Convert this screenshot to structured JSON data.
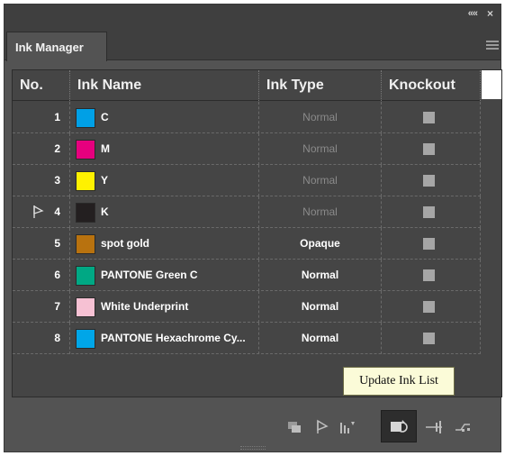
{
  "panel": {
    "tab_label": "Ink Manager",
    "collapse_glyph": "««",
    "close_glyph": "×"
  },
  "table": {
    "headers": {
      "no": "No.",
      "name": "Ink Name",
      "type": "Ink Type",
      "knockout": "Knockout"
    },
    "rows": [
      {
        "no": "1",
        "name": "C",
        "color": "#00a0e6",
        "type": "Normal",
        "type_style": "dim",
        "flag": false
      },
      {
        "no": "2",
        "name": "M",
        "color": "#e6007e",
        "type": "Normal",
        "type_style": "dim",
        "flag": false
      },
      {
        "no": "3",
        "name": "Y",
        "color": "#fff100",
        "type": "Normal",
        "type_style": "dim",
        "flag": false
      },
      {
        "no": "4",
        "name": "K",
        "color": "#231f20",
        "type": "Normal",
        "type_style": "dim",
        "flag": true
      },
      {
        "no": "5",
        "name": "spot gold",
        "color": "#b8720f",
        "type": "Opaque",
        "type_style": "bright",
        "flag": false
      },
      {
        "no": "6",
        "name": "PANTONE Green C",
        "color": "#00a884",
        "type": "Normal",
        "type_style": "bright",
        "flag": false
      },
      {
        "no": "7",
        "name": "White Underprint",
        "color": "#f6c1d3",
        "type": "Normal",
        "type_style": "bright",
        "flag": false
      },
      {
        "no": "8",
        "name": "PANTONE Hexachrome Cy...",
        "color": "#00a6e8",
        "type": "Normal",
        "type_style": "bright",
        "flag": false
      }
    ]
  },
  "tooltip": {
    "text": "Update Ink List"
  },
  "toolbar": {
    "icons": [
      "ink-layer-icon",
      "flag-icon",
      "sort-icon",
      "update-ink-list-icon",
      "split-icon",
      "link-icon"
    ]
  },
  "colors": {
    "panel_bg": "#535353",
    "table_bg": "#454545",
    "titlebar_bg": "#3f3f3f",
    "tooltip_bg": "#fbfbd8"
  }
}
